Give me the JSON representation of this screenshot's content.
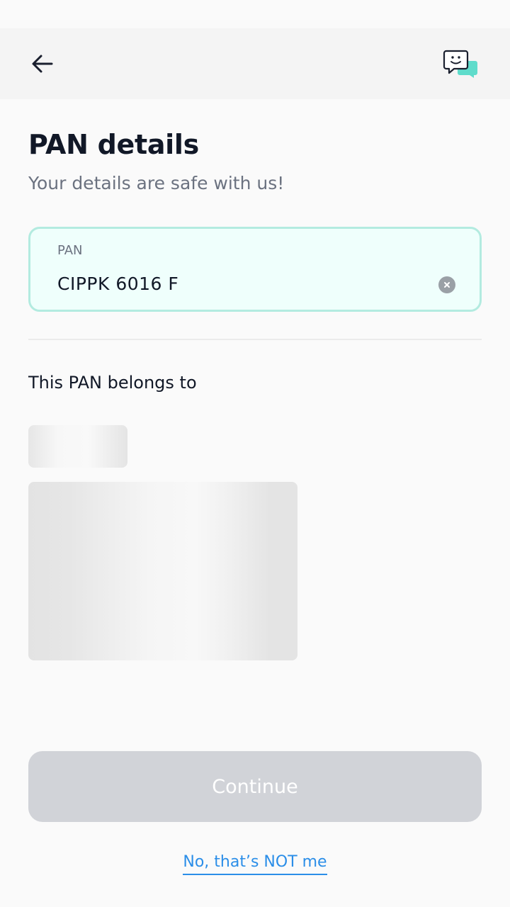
{
  "header": {
    "back_icon": "arrow-left-icon",
    "chat_icon": "chat-support-icon",
    "chat_accent_color": "#5fdccb"
  },
  "page": {
    "title": "PAN details",
    "subtitle": "Your details are safe with us!"
  },
  "pan_field": {
    "label": "PAN",
    "value": "CIPPK 6016 F",
    "clear_icon": "clear-icon"
  },
  "owner_section": {
    "label": "This PAN belongs to"
  },
  "actions": {
    "continue_label": "Continue",
    "continue_disabled": true,
    "not_me_label": "No, that’s NOT me"
  },
  "colors": {
    "field_border": "#b3ebe0",
    "field_background": "#effffc",
    "link": "#2b8ee8",
    "button_disabled": "#d1d3d8"
  }
}
